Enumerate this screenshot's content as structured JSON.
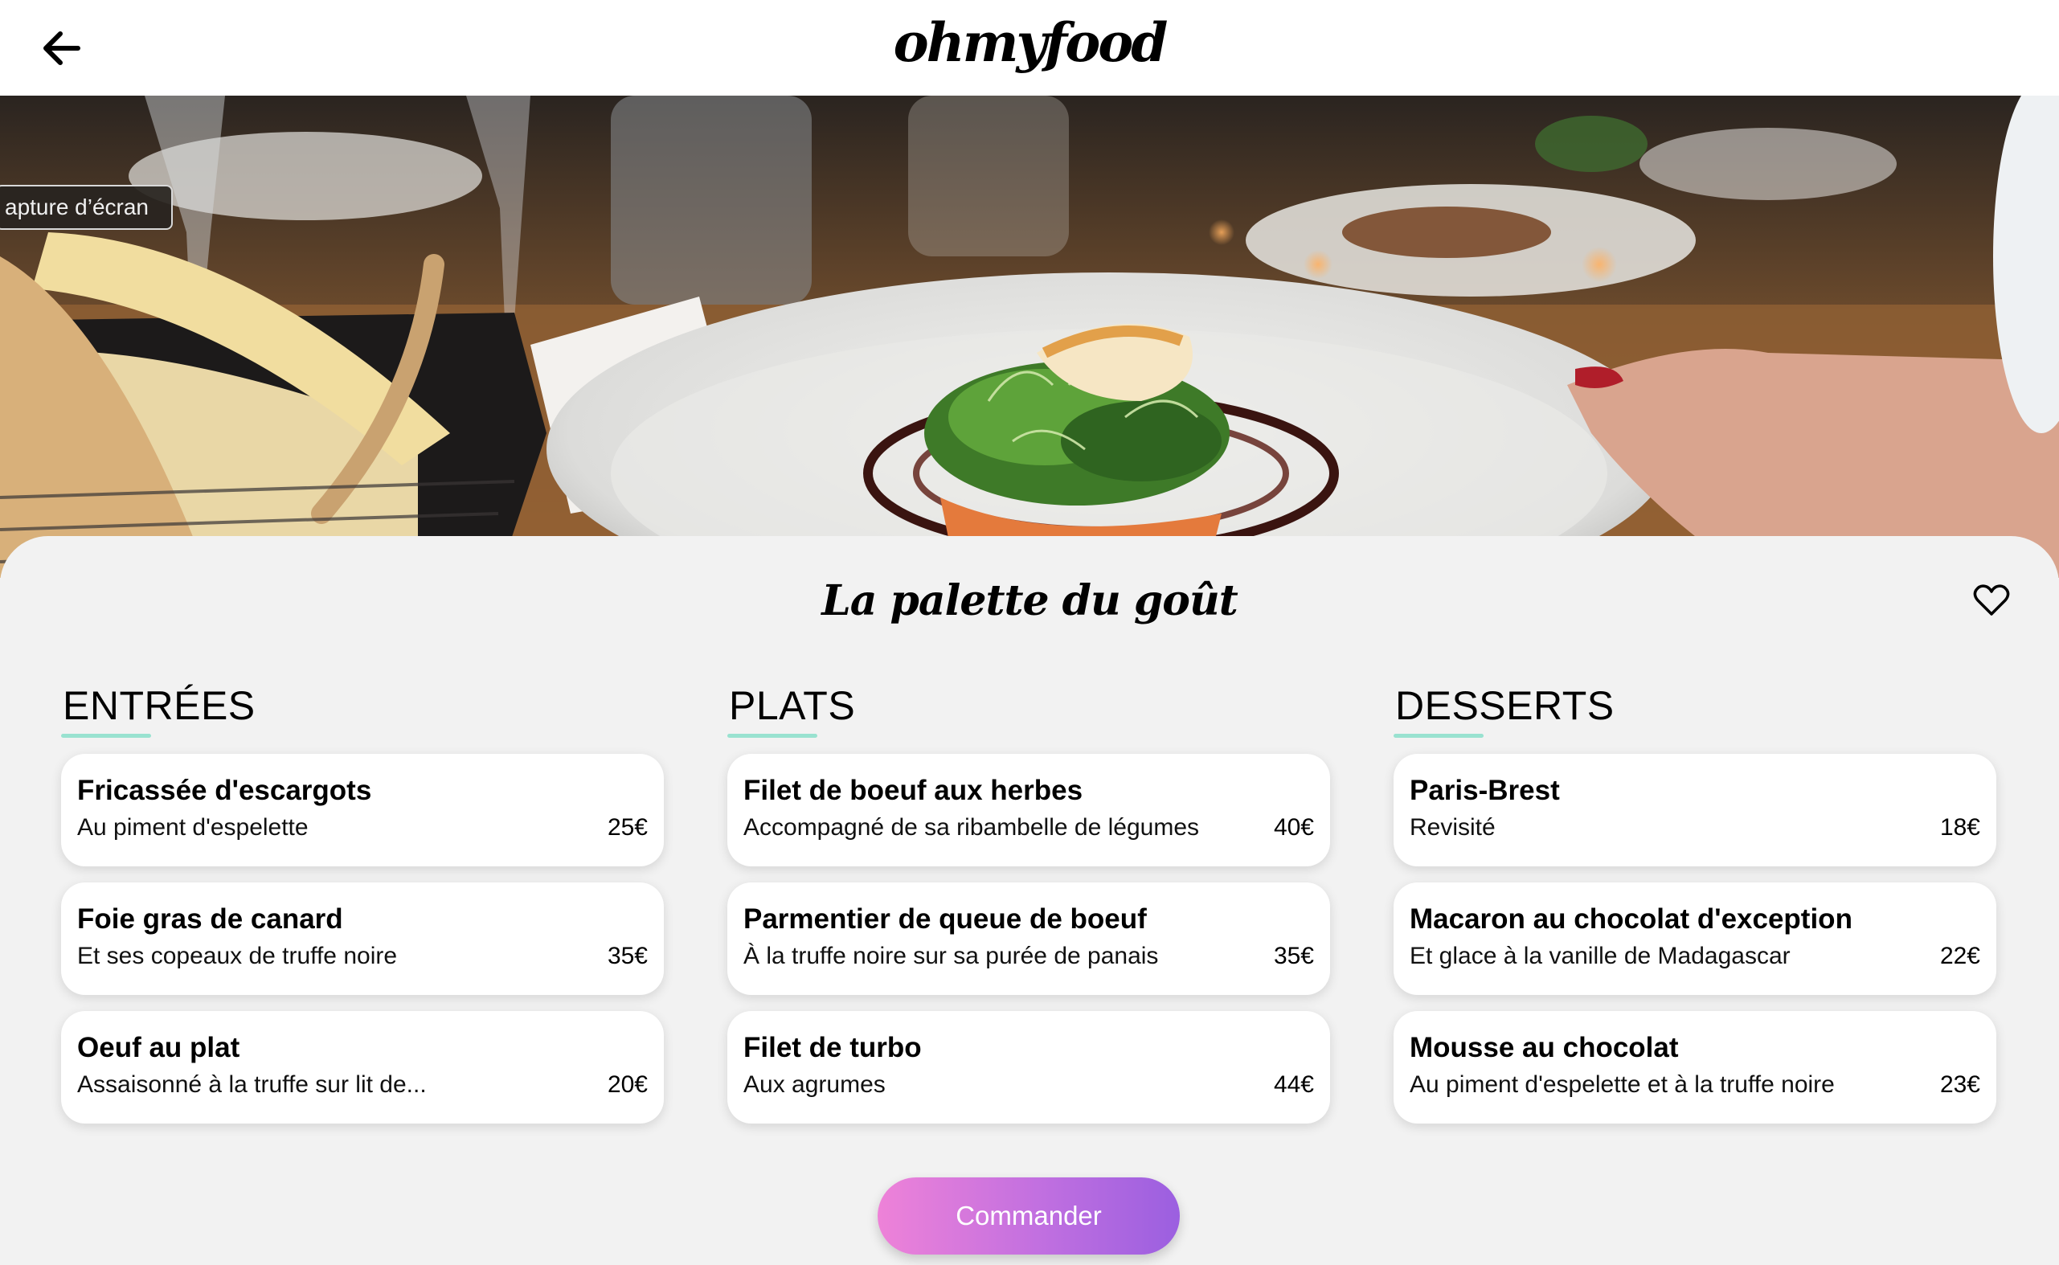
{
  "header": {
    "logo": "ohmyfood",
    "back_icon": "arrow-left-icon"
  },
  "hero": {
    "overlay_badge": "apture d’écran"
  },
  "restaurant": {
    "name": "La palette du goût",
    "favorite_icon": "heart-outline-icon"
  },
  "menu": {
    "sections": [
      {
        "title": "ENTRÉES",
        "dishes": [
          {
            "name": "Fricassée d'escargots",
            "description": "Au piment d'espelette",
            "price": "25€"
          },
          {
            "name": "Foie gras de canard",
            "description": "Et ses copeaux de truffe noire",
            "price": "35€"
          },
          {
            "name": "Oeuf au plat",
            "description": "Assaisonné à la truffe sur lit de...",
            "price": "20€"
          }
        ]
      },
      {
        "title": "PLATS",
        "dishes": [
          {
            "name": "Filet de boeuf aux herbes",
            "description": "Accompagné de sa ribambelle de légumes",
            "price": "40€"
          },
          {
            "name": "Parmentier de queue de boeuf",
            "description": "À la truffe noire sur sa purée de panais",
            "price": "35€"
          },
          {
            "name": "Filet de turbo",
            "description": "Aux agrumes",
            "price": "44€"
          }
        ]
      },
      {
        "title": "DESSERTS",
        "dishes": [
          {
            "name": "Paris-Brest",
            "description": "Revisité",
            "price": "18€"
          },
          {
            "name": "Macaron au chocolat d'exception",
            "description": "Et glace à la vanille de Madagascar",
            "price": "22€"
          },
          {
            "name": "Mousse au chocolat",
            "description": "Au piment d'espelette et à la truffe noire",
            "price": "23€"
          }
        ]
      }
    ]
  },
  "order_button": "Commander",
  "colors": {
    "accent_underline": "#99e2d0",
    "button_gradient_start": "#ee82d8",
    "button_gradient_end": "#9b5fe0",
    "page_background": "#f2f2f2"
  }
}
